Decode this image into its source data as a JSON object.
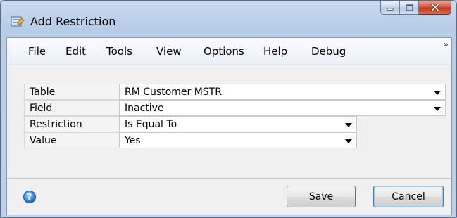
{
  "window": {
    "title": "Add Restriction",
    "icon": "dexterity-app-icon"
  },
  "caption_buttons": [
    "minimize-icon",
    "maximize-icon",
    "close-icon"
  ],
  "menu": {
    "items": [
      "File",
      "Edit",
      "Tools",
      "View",
      "Options",
      "Help",
      "Debug"
    ],
    "overflow": "»"
  },
  "form": {
    "rows": [
      {
        "label": "Table",
        "value": "RM Customer MSTR"
      },
      {
        "label": "Field",
        "value": "Inactive"
      },
      {
        "label": "Restriction",
        "value": "Is Equal To"
      },
      {
        "label": "Value",
        "value": "Yes"
      }
    ]
  },
  "footer": {
    "help_icon": "help-icon",
    "help_glyph": "?",
    "save_label": "Save",
    "cancel_label": "Cancel"
  }
}
